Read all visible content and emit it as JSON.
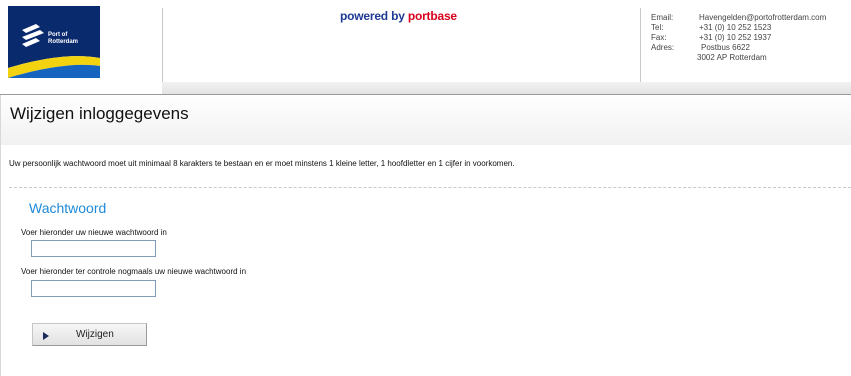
{
  "header": {
    "logo": {
      "text_line1": "Port of",
      "text_line2": "Rotterdam",
      "colors": {
        "navy": "#0a2a6e",
        "yellow": "#f3d210",
        "blue": "#1564c0"
      }
    },
    "powered_prefix": "powered by ",
    "powered_brand": "portbase",
    "contact": {
      "email_label": "Email:",
      "email_value": "Havengelden@portofrotterdam.com",
      "tel_label": "Tel:",
      "tel_value": "+31 (0) 10 252 1523",
      "fax_label": "Fax:",
      "fax_value": "+31 (0) 10 252 1937",
      "address_label": "Adres:",
      "address_line1": "Postbus 6622",
      "address_line2": "3002 AP  Rotterdam"
    }
  },
  "page": {
    "title": "Wijzigen inloggegevens",
    "instruction": "Uw persoonlijk wachtwoord moet uit minimaal 8 karakters te bestaan en er moet minstens 1 kleine letter, 1 hoofdletter en 1 cijfer in voorkomen."
  },
  "form": {
    "section_title": "Wachtwoord",
    "new_password_label": "Voer hieronder uw nieuwe wachtwoord in",
    "new_password_value": "",
    "confirm_password_label": "Voer hieronder ter controle nogmaals uw nieuwe wachtwoord in",
    "confirm_password_value": "",
    "submit_label": "Wijzigen",
    "submit_icon": "play-arrow-icon"
  },
  "colors": {
    "accent_blue": "#1f8ad8",
    "portbase_red": "#d6001c",
    "powered_navy": "#1f3a93"
  }
}
